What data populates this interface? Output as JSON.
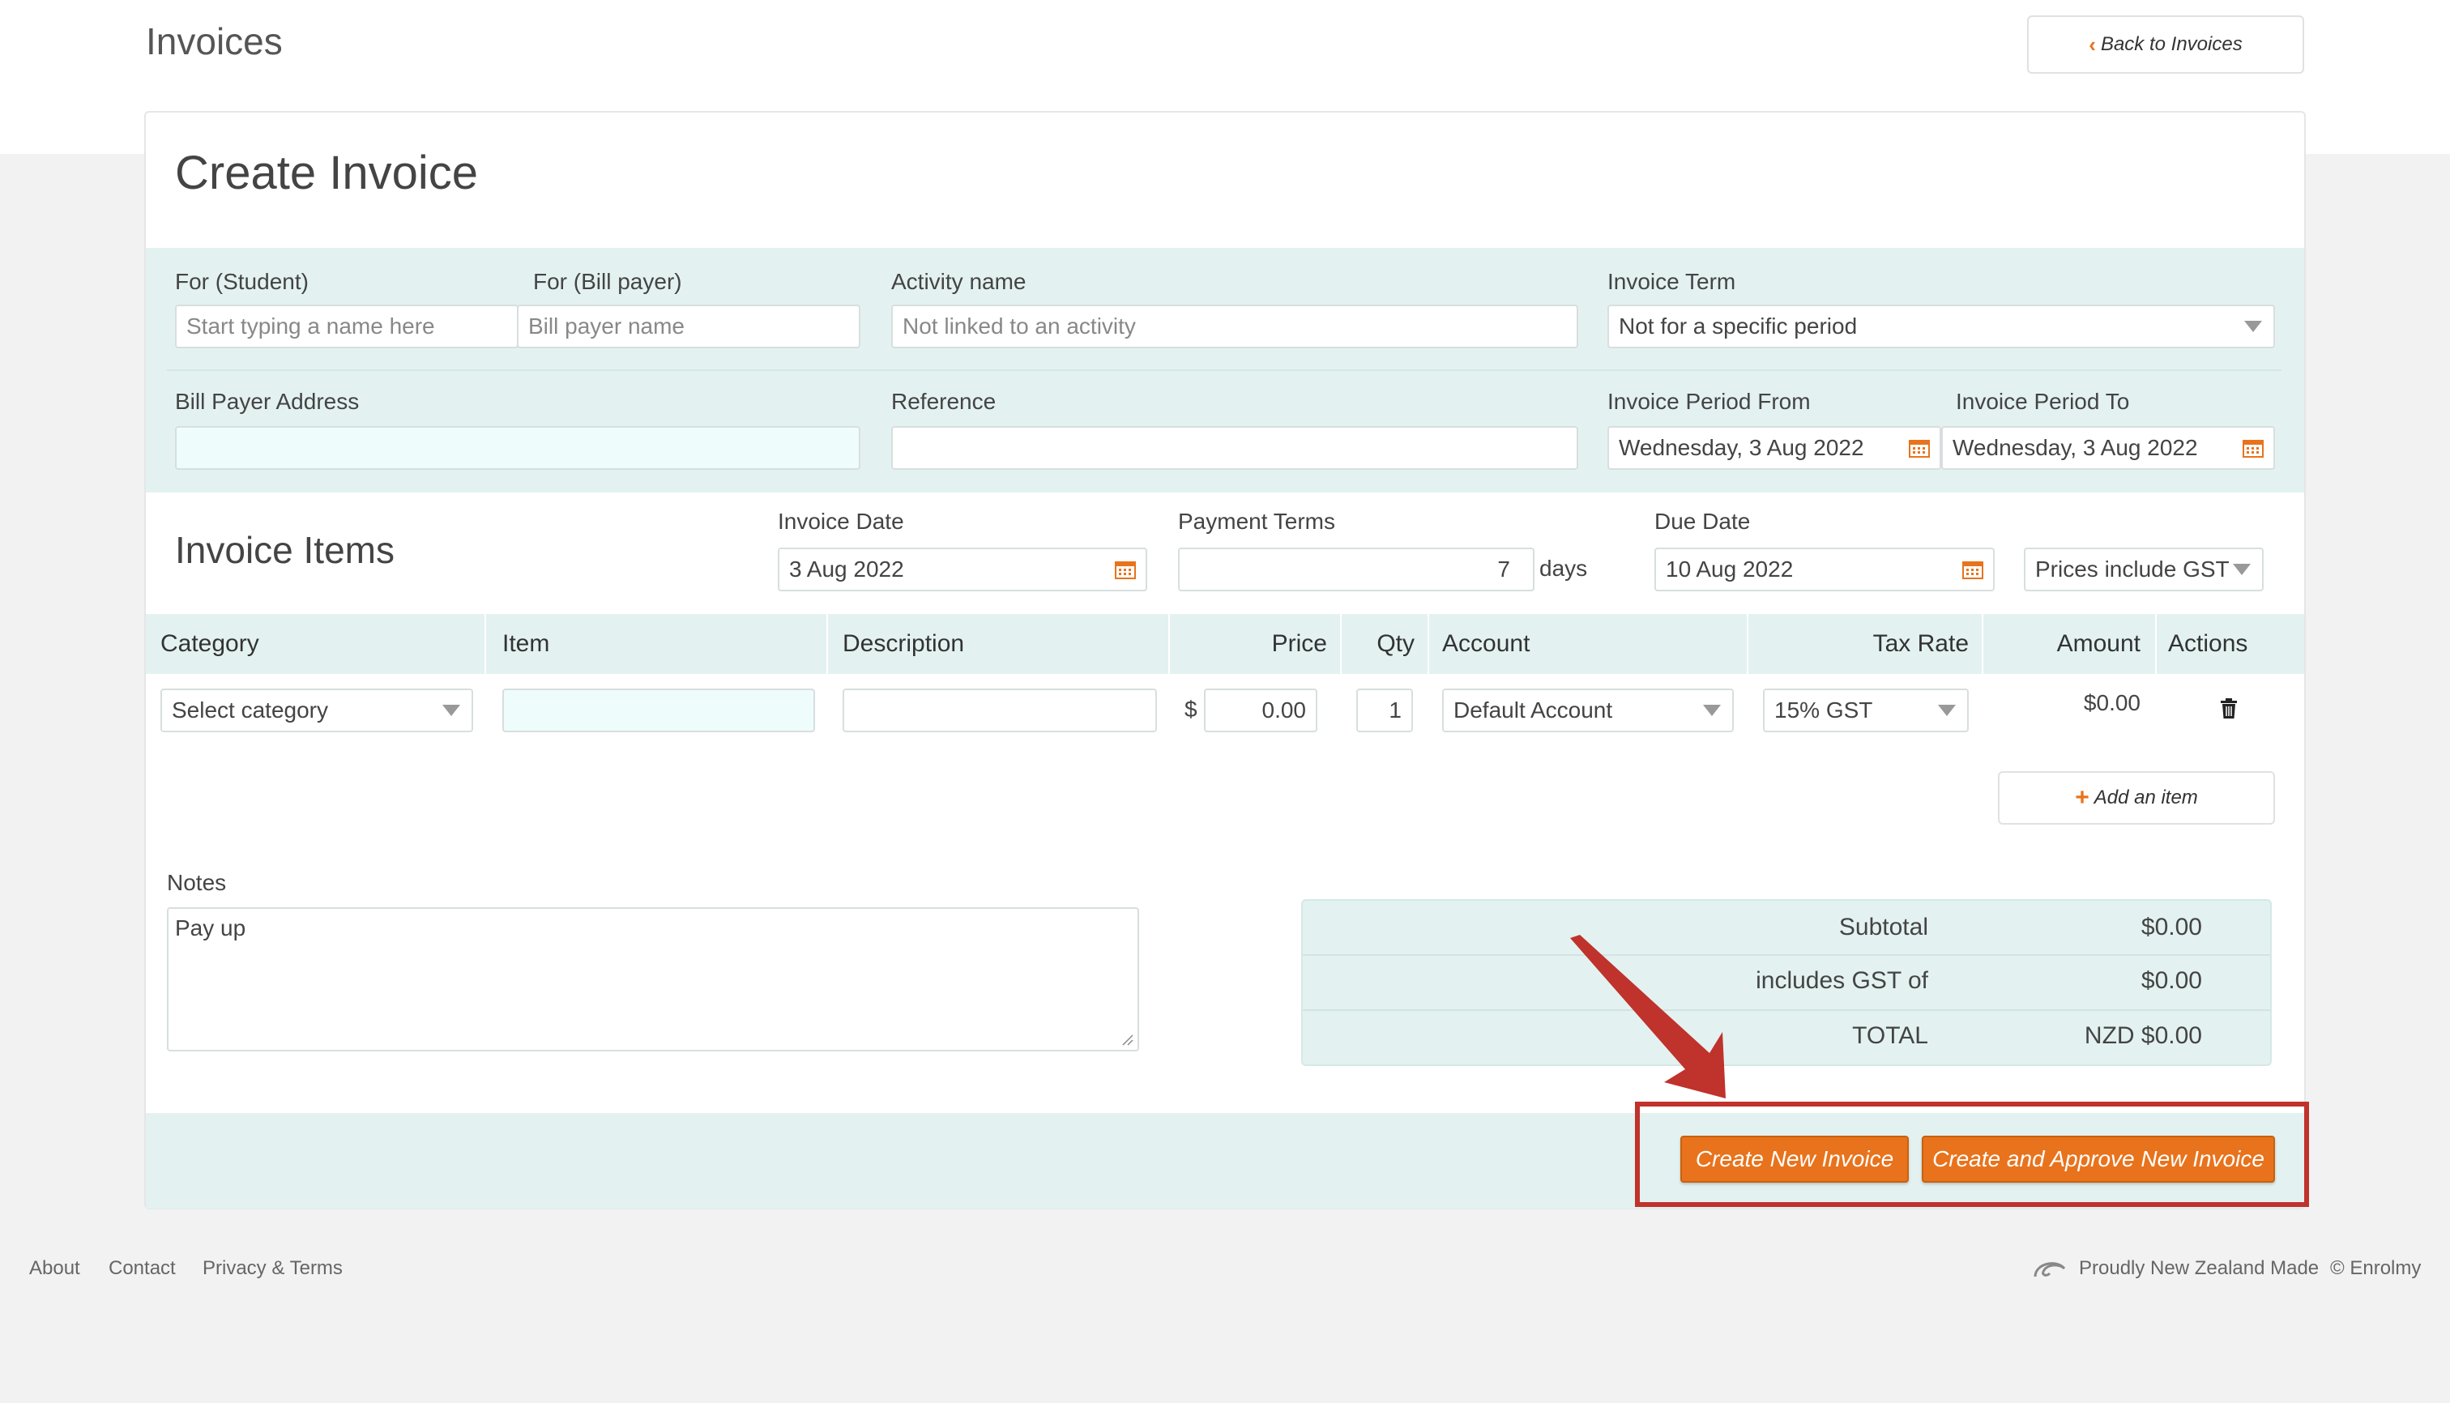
{
  "header": {
    "title": "Invoices",
    "back_label": "Back to Invoices"
  },
  "form": {
    "title": "Create Invoice",
    "student": {
      "label": "For (Student)",
      "placeholder": "Start typing a name here"
    },
    "bill_payer": {
      "label": "For (Bill payer)",
      "placeholder": "Bill payer name"
    },
    "activity": {
      "label": "Activity name",
      "placeholder": "Not linked to an activity"
    },
    "invoice_term": {
      "label": "Invoice Term",
      "value": "Not for a specific period"
    },
    "bill_address": {
      "label": "Bill Payer Address",
      "value": ""
    },
    "reference": {
      "label": "Reference",
      "value": ""
    },
    "period_from": {
      "label": "Invoice Period From",
      "value": "Wednesday, 3 Aug 2022"
    },
    "period_to": {
      "label": "Invoice Period To",
      "value": "Wednesday, 3 Aug 2022"
    }
  },
  "items_section": {
    "title": "Invoice Items",
    "invoice_date": {
      "label": "Invoice Date",
      "value": "3 Aug 2022"
    },
    "payment_terms": {
      "label": "Payment Terms",
      "value": "7",
      "suffix": "days"
    },
    "due_date": {
      "label": "Due Date",
      "value": "10 Aug 2022"
    },
    "gst_mode": "Prices include GST"
  },
  "table": {
    "columns": [
      "Category",
      "Item",
      "Description",
      "Price",
      "Qty",
      "Account",
      "Tax Rate",
      "Amount",
      "Actions"
    ],
    "row": {
      "category": "Select category",
      "item": "",
      "description": "",
      "currency_symbol": "$",
      "price": "0.00",
      "qty": "1",
      "account": "Default Account",
      "tax_rate": "15% GST",
      "amount": "$0.00"
    },
    "add_item_label": "Add an item"
  },
  "notes": {
    "label": "Notes",
    "value": "Pay up"
  },
  "totals": {
    "subtotal_label": "Subtotal",
    "subtotal": "$0.00",
    "gst_label": "includes GST of",
    "gst": "$0.00",
    "total_label": "TOTAL",
    "total": "NZD $0.00"
  },
  "actions": {
    "create_label": "Create New Invoice",
    "create_approve_label": "Create and Approve New Invoice"
  },
  "footer": {
    "links": [
      "About",
      "Contact",
      "Privacy & Terms"
    ],
    "made_in": "Proudly New Zealand Made",
    "copyright": "© Enrolmy"
  },
  "colors": {
    "accent": "#e8731c",
    "teal_bg": "#e3f2f1",
    "highlight": "#c0322c"
  }
}
